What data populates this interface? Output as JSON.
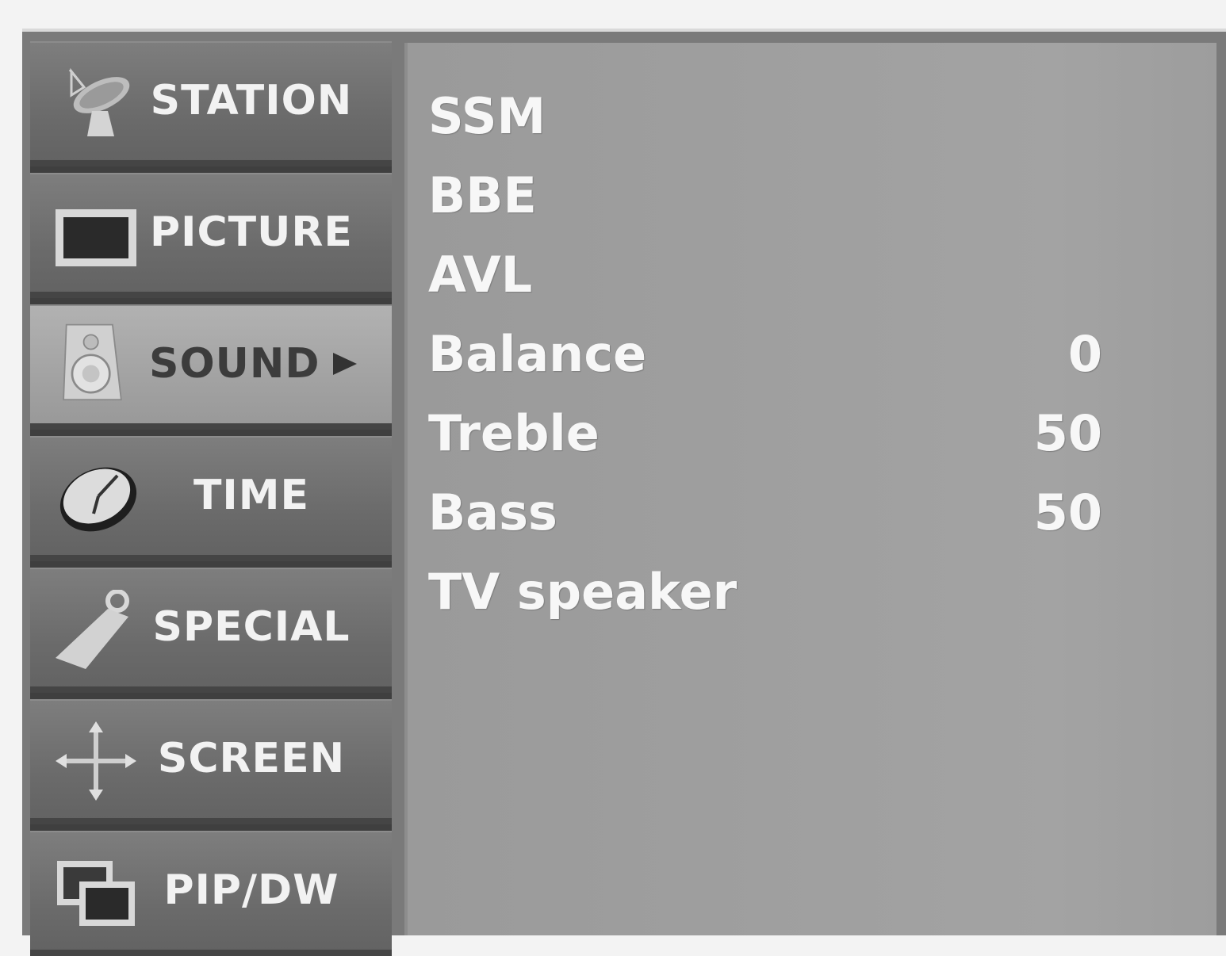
{
  "menu": {
    "items": [
      {
        "label": "STATION",
        "icon": "satellite-dish-icon"
      },
      {
        "label": "PICTURE",
        "icon": "monitor-icon"
      },
      {
        "label": "SOUND",
        "icon": "speaker-icon",
        "active": true
      },
      {
        "label": "TIME",
        "icon": "clock-icon"
      },
      {
        "label": "SPECIAL",
        "icon": "tag-icon"
      },
      {
        "label": "SCREEN",
        "icon": "move-arrows-icon"
      },
      {
        "label": "PIP/DW",
        "icon": "pip-windows-icon"
      }
    ]
  },
  "sound": {
    "rows": [
      {
        "label": "SSM",
        "value": ""
      },
      {
        "label": "BBE",
        "value": ""
      },
      {
        "label": "AVL",
        "value": ""
      },
      {
        "label": "Balance",
        "value": "0"
      },
      {
        "label": "Treble",
        "value": "50"
      },
      {
        "label": "Bass",
        "value": "50"
      },
      {
        "label": "TV speaker",
        "value": ""
      }
    ]
  },
  "colors": {
    "panel": "#a3a3a3",
    "menu_item": "#6b6b6b",
    "menu_item_active": "#a2a2a2",
    "text": "#f7f7f7"
  }
}
